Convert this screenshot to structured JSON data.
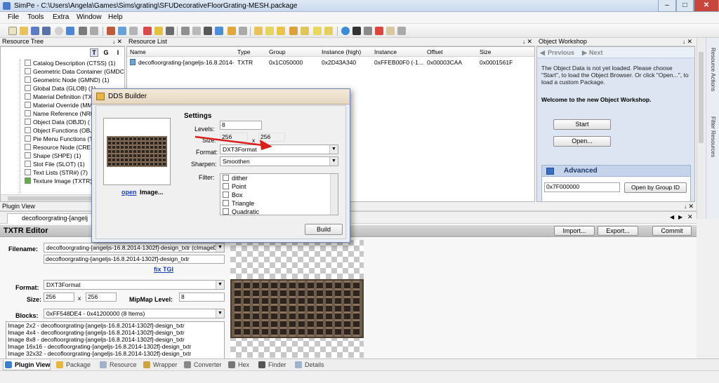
{
  "window": {
    "title": "SimPe - C:\\Users\\Angela\\Games\\Sims\\grating\\SFUDecorativeFloorGrating-MESH.package",
    "min": "–",
    "max": "□",
    "close": "✕"
  },
  "menu": [
    "File",
    "Tools",
    "Extra",
    "Window",
    "Help"
  ],
  "resource_tree": {
    "title": "Resource Tree",
    "buttons": [
      "T",
      "G",
      "I"
    ],
    "items": [
      "Catalog Description (CTSS) (1)",
      "Geometric Data Container (GMDC",
      "Geometric Node (GMND) (1)",
      "Global Data (GLOB) (1)",
      "Material Definition (TXM",
      "Material Override (MM",
      "Name Reference (NRE",
      "Object Data (OBJD) (",
      "Object Functions (OBJ",
      "Pie Menu Functions (T",
      "Resource Node (CRES",
      "Shape (SHPE) (1)",
      "Slot File (SLOT) (1)",
      "Text Lists (STR#) (7)",
      "Texture Image (TXTR)"
    ]
  },
  "resource_list": {
    "title": "Resource List",
    "columns": [
      "Name",
      "Type",
      "Group",
      "Instance (high)",
      "Instance",
      "Offset",
      "Size"
    ],
    "rows": [
      [
        "decofloorgrating-[angeljs-16.8.2014-",
        "TXTR",
        "0x1C050000",
        "0x2D43A340",
        "0xFFEB00F0 (-1...",
        "0x00003CAA",
        "0x0001561F"
      ]
    ]
  },
  "object_workshop": {
    "title": "Object Workshop",
    "previous": "Previous",
    "next": "Next",
    "message": "The Object Data is not yet loaded. Please choose \"Start\", to load the Object Browser. Or click \"Open...\", to load a custom Package.",
    "welcome": "Welcome to the new Object Workshop.",
    "start": "Start",
    "open": "Open...",
    "advanced": "Advanced",
    "group_id": "0x7F000000",
    "open_by_group": "Open by Group ID"
  },
  "side_tabs": [
    "Resource Actions",
    "Filter Resources"
  ],
  "plugin_view": {
    "title": "Plugin View",
    "tab": "decofloorgrating-[angelj",
    "editor_title": "TXTR Editor",
    "import": "Import...",
    "export": "Export...",
    "commit": "Commit",
    "filename_label": "Filename:",
    "filename_value": "decofloorgrating-[angeljs-16.8.2014-1302f]-design_txtr (cImageD",
    "filename_sub": "decofloorgrating-[angeljs-16.8.2014-1302f]-design_txtr",
    "fix_tgi": "fix TGI",
    "format_label": "Format:",
    "format_value": "DXT3Format",
    "size_label": "Size:",
    "size_w": "256",
    "size_h": "256",
    "size_x": "x",
    "mipmap_label": "MipMap Level:",
    "mipmap_value": "8",
    "blocks_label": "Blocks:",
    "blocks_value": "0xFF548DE4 - 0x41200000 (8 Items)",
    "images": [
      "Image 2x2 - decofloorgrating-[angeljs-16.8.2014-1302f]-design_txtr",
      "Image 4x4 - decofloorgrating-[angeljs-16.8.2014-1302f]-design_txtr",
      "Image 8x8 - decofloorgrating-[angeljs-16.8.2014-1302f]-design_txtr",
      "Image 16x16 - decofloorgrating-[angeljs-16.8.2014-1302f]-design_txtr",
      "Image 32x32 - decofloorgrating-[angeljs-16.8.2014-1302f]-design_txtr"
    ]
  },
  "bottom_tabs": [
    "Plugin View",
    "Package",
    "Resource",
    "Wrapper",
    "Converter",
    "Hex",
    "Finder",
    "Details"
  ],
  "dds_builder": {
    "title": "DDS Builder",
    "open_link": "open",
    "image_label": "Image...",
    "settings": "Settings",
    "levels_label": "Levels:",
    "levels_value": "8",
    "size_label": "Size:",
    "size_w": "256",
    "size_x": "x",
    "size_h": "256",
    "format_label": "Format:",
    "format_value": "DXT3Format",
    "sharpen_label": "Sharpen:",
    "sharpen_value": "Smoothen",
    "filter_label": "Filter:",
    "filters": [
      "dither",
      "Point",
      "Box",
      "Triangle",
      "Quadratic"
    ],
    "build": "Build"
  },
  "icons": {
    "combo_arrow": "▼",
    "pin": "↓",
    "close_small": "✕",
    "nav_prev": "◀",
    "nav_next": "▶"
  }
}
